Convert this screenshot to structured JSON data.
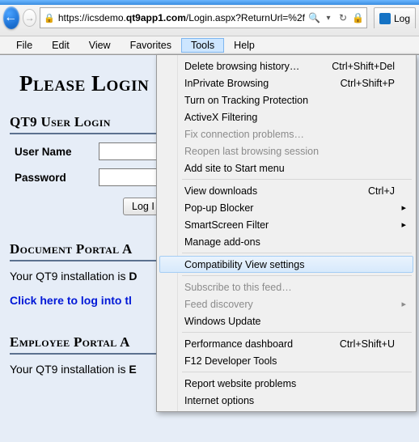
{
  "browser": {
    "url_prefix": "https://icsdemo.",
    "url_domain": "qt9app1.com",
    "url_suffix": "/Login.aspx?ReturnUrl=%2f",
    "tab_label": "Log"
  },
  "menubar": {
    "file": "File",
    "edit": "Edit",
    "view": "View",
    "favorites": "Favorites",
    "tools": "Tools",
    "help": "Help"
  },
  "tools_menu": {
    "delete_history": "Delete browsing history…",
    "delete_history_sc": "Ctrl+Shift+Del",
    "inprivate": "InPrivate Browsing",
    "inprivate_sc": "Ctrl+Shift+P",
    "tracking": "Turn on Tracking Protection",
    "activex": "ActiveX Filtering",
    "fix_conn": "Fix connection problems…",
    "reopen": "Reopen last browsing session",
    "add_start": "Add site to Start menu",
    "view_dl": "View downloads",
    "view_dl_sc": "Ctrl+J",
    "popup": "Pop-up Blocker",
    "smartscreen": "SmartScreen Filter",
    "addons": "Manage add-ons",
    "compat": "Compatibility View settings",
    "subscribe": "Subscribe to this feed…",
    "feed": "Feed discovery",
    "winupdate": "Windows Update",
    "perf": "Performance dashboard",
    "perf_sc": "Ctrl+Shift+U",
    "f12": "F12 Developer Tools",
    "report": "Report website problems",
    "inet": "Internet options"
  },
  "page": {
    "h1": "Please Login",
    "user_login_h": "QT9 User Login",
    "username_label": "User Name",
    "password_label": "Password",
    "login_btn": "Log I",
    "doc_portal_h": "Document Portal A",
    "doc_desc_a": "Your QT9 installation is ",
    "doc_desc_b": "D",
    "doc_link": "Click here to log into tl",
    "emp_portal_h": "Employee Portal A",
    "emp_desc_a": "Your QT9 installation is ",
    "emp_desc_b": "E"
  }
}
